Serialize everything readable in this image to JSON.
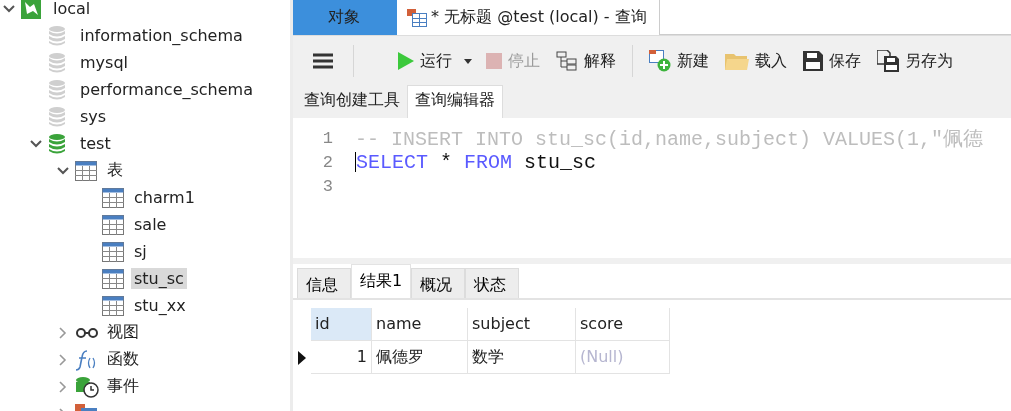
{
  "sidebar": {
    "tree": [
      {
        "label": "local",
        "kind": "connection",
        "expanded": true,
        "selected": false,
        "children": [
          {
            "label": "information_schema",
            "kind": "database",
            "open": false,
            "selected": false
          },
          {
            "label": "mysql",
            "kind": "database",
            "open": false,
            "selected": false
          },
          {
            "label": "performance_schema",
            "kind": "database",
            "open": false,
            "selected": false
          },
          {
            "label": "sys",
            "kind": "database",
            "open": false,
            "selected": false
          },
          {
            "label": "test",
            "kind": "database",
            "open": true,
            "expanded": true,
            "selected": false,
            "children": [
              {
                "label": "表",
                "kind": "tables",
                "expanded": true,
                "selected": false,
                "children": [
                  {
                    "label": "charm1",
                    "kind": "table",
                    "selected": false
                  },
                  {
                    "label": "sale",
                    "kind": "table",
                    "selected": false
                  },
                  {
                    "label": "sj",
                    "kind": "table",
                    "selected": false
                  },
                  {
                    "label": "stu_sc",
                    "kind": "table",
                    "selected": true
                  },
                  {
                    "label": "stu_xx",
                    "kind": "table",
                    "selected": false
                  }
                ]
              },
              {
                "label": "视图",
                "kind": "views",
                "expanded": false,
                "selected": false
              },
              {
                "label": "函数",
                "kind": "functions",
                "expanded": false,
                "selected": false
              },
              {
                "label": "事件",
                "kind": "events",
                "expanded": false,
                "selected": false
              },
              {
                "kind": "queries",
                "expanded": false
              }
            ]
          }
        ]
      }
    ]
  },
  "tabs": [
    {
      "label": "对象",
      "kind": "objects",
      "selected": false
    },
    {
      "label": "* 无标题 @test (local) - 查询",
      "kind": "query",
      "selected": true
    }
  ],
  "toolbar": [
    {
      "kind": "menu"
    },
    {
      "kind": "sep"
    },
    {
      "kind": "run",
      "label": "运行",
      "disabled": false
    },
    {
      "kind": "stop",
      "label": "停止",
      "disabled": true
    },
    {
      "kind": "explain",
      "label": "解释",
      "disabled": false
    },
    {
      "kind": "sep"
    },
    {
      "kind": "new",
      "label": "新建",
      "disabled": false
    },
    {
      "kind": "load",
      "label": "载入",
      "disabled": false
    },
    {
      "kind": "save",
      "label": "保存",
      "disabled": false
    },
    {
      "kind": "saveas",
      "label": "另存为",
      "disabled": false
    }
  ],
  "subtabs": [
    {
      "label": "查询创建工具",
      "selected": false
    },
    {
      "label": "查询编辑器",
      "selected": true
    }
  ],
  "editor": {
    "lines": [
      {
        "number": "1",
        "cursor": false,
        "tokens": [
          {
            "kind": "comment",
            "text": "-- INSERT INTO stu_sc(id,name,subject) VALUES(1,\"佩德"
          }
        ]
      },
      {
        "number": "2",
        "cursor": true,
        "tokens": [
          {
            "kind": "keyword",
            "text": "SELECT"
          },
          {
            "kind": "plain",
            "text": " * "
          },
          {
            "kind": "keyword",
            "text": "FROM"
          },
          {
            "kind": "plain",
            "text": " stu_sc"
          }
        ]
      },
      {
        "number": "3",
        "cursor": false
      }
    ]
  },
  "result_tabs": [
    {
      "label": "信息",
      "selected": false
    },
    {
      "label": "结果1",
      "selected": true
    },
    {
      "label": "概况",
      "selected": false
    },
    {
      "label": "状态",
      "selected": false
    }
  ],
  "grid": {
    "columns": [
      {
        "label": "id",
        "selected": true
      },
      {
        "label": "name",
        "selected": false
      },
      {
        "label": "subject",
        "selected": false
      },
      {
        "label": "score",
        "selected": false
      }
    ],
    "rows": [
      {
        "current": true,
        "cells": [
          {
            "kind": "number",
            "text": "1"
          },
          {
            "kind": "text",
            "text": "佩德罗"
          },
          {
            "kind": "text",
            "text": "数学"
          },
          {
            "kind": "null",
            "text": "(Null)"
          }
        ]
      }
    ]
  }
}
